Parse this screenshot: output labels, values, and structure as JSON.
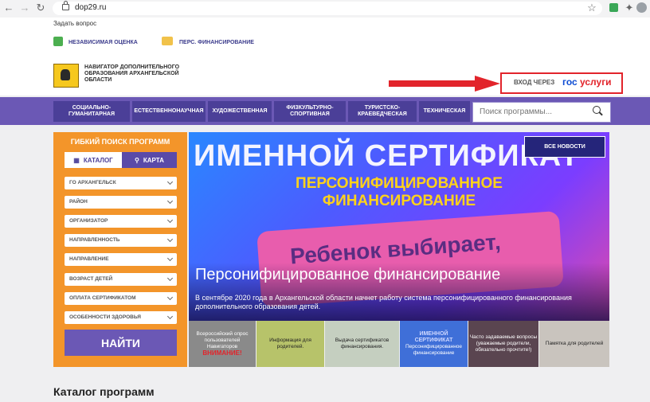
{
  "browser": {
    "url": "dop29.ru"
  },
  "bookmarks": {
    "ask_question": "Задать вопрос"
  },
  "top_links": {
    "independent_assessment": "НЕЗАВИСИМАЯ ОЦЕНКА",
    "pers_financing": "ПЕРС. ФИНАНСИРОВАНИЕ"
  },
  "header": {
    "brand_line1": "НАВИГАТОР ДОПОЛНИТЕЛЬНОГО",
    "brand_line2": "ОБРАЗОВАНИЯ АРХАНГЕЛЬСКОЙ",
    "brand_line3": "ОБЛАСТИ",
    "login_prefix": "ВХОД ЧЕРЕЗ",
    "login_gos": "гос",
    "login_uslugi": "услуги"
  },
  "categories": [
    {
      "line1": "СОЦИАЛЬНО-",
      "line2": "ГУМАНИТАРНАЯ"
    },
    {
      "line1": "ЕСТЕСТВЕННОНАУЧНАЯ",
      "line2": ""
    },
    {
      "line1": "ХУДОЖЕСТВЕННАЯ",
      "line2": ""
    },
    {
      "line1": "ФИЗКУЛЬТУРНО-",
      "line2": "СПОРТИВНАЯ"
    },
    {
      "line1": "ТУРИСТСКО-",
      "line2": "КРАЕВЕДЧЕСКАЯ"
    },
    {
      "line1": "ТЕХНИЧЕСКАЯ",
      "line2": ""
    }
  ],
  "search": {
    "placeholder": "Поиск программы..."
  },
  "sidebar": {
    "title": "ГИБКИЙ ПОИСК ПРОГРАММ",
    "tab_catalog": "КАТАЛОГ",
    "tab_map": "КАРТА",
    "selects": [
      "ГО АРХАНГЕЛЬСК",
      "РАЙОН",
      "ОРГАНИЗАТОР",
      "НАПРАВЛЕННОСТЬ",
      "НАПРАВЛЕНИЕ",
      "ВОЗРАСТ ДЕТЕЙ",
      "ОПЛАТА СЕРТИФИКАТОМ",
      "ОСОБЕННОСТИ ЗДОРОВЬЯ"
    ],
    "find_button": "НАЙТИ"
  },
  "banner": {
    "title": "ИМЕННОЙ СЕРТИФИКАТ",
    "subtitle1": "ПЕРСОНИФИЦИРОВАННОЕ",
    "subtitle2": "ФИНАНСИРОВАНИЕ",
    "child_text": "Ребенок выбирает,",
    "all_news": "ВСЕ НОВОСТИ",
    "overlay_title": "Персонифицированное финансирование",
    "overlay_text": "В сентябре 2020 года в Архангельской области начнет работу система персонифицированного финансирования дополнительного образования детей."
  },
  "tiles": [
    {
      "label": "Всероссийский опрос пользователей Навигаторов",
      "sub": "ВНИМАНИЕ!"
    },
    {
      "label": "Информация для родителей.",
      "sub": ""
    },
    {
      "label": "Выдача сертификатов финансирования.",
      "sub": ""
    },
    {
      "label": "Персонифицированное финансирование",
      "sub": "ИМЕННОЙ СЕРТИФИКАТ"
    },
    {
      "label": "Часто задаваемые вопросы (уважаемые родители, обязательно прочтите!)",
      "sub": ""
    },
    {
      "label": "Памятка для родителей",
      "sub": ""
    }
  ],
  "catalog": {
    "title": "Каталог программ"
  },
  "colors": {
    "accent": "#6b58b5",
    "orange": "#f3952a",
    "red": "#e2242b",
    "gos_blue": "#0d4cd3"
  }
}
